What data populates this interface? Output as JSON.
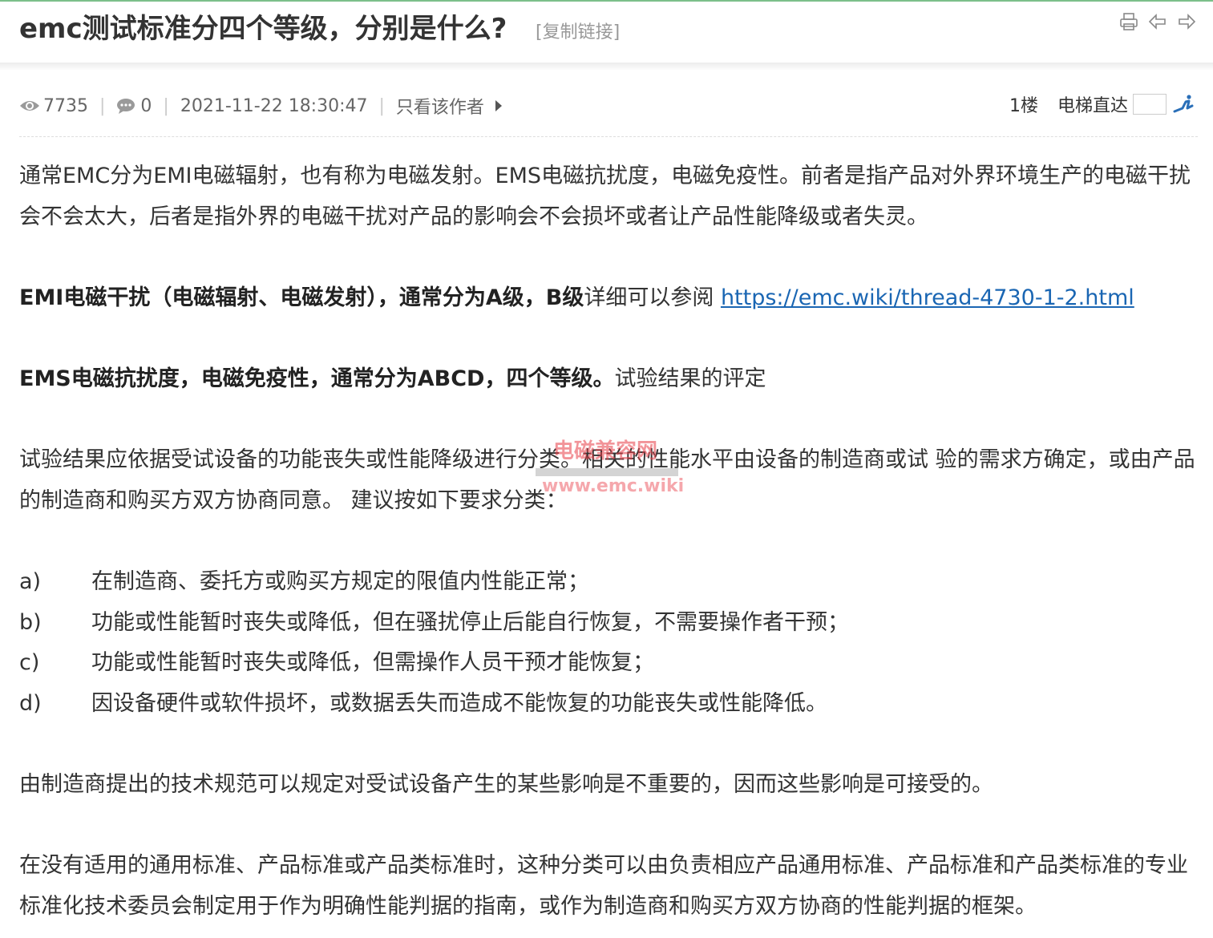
{
  "header": {
    "title": "emc测试标准分四个等级，分别是什么?",
    "copy_link": "[复制链接]",
    "icons": [
      "print-icon",
      "previous-thread-icon",
      "next-thread-icon"
    ]
  },
  "meta": {
    "views": "7735",
    "replies": "0",
    "datetime": "2021-11-22 18:30:47",
    "only_author": "只看该作者"
  },
  "floor": {
    "number": "1楼",
    "jump_label": "电梯直达",
    "jump_value": ""
  },
  "post": {
    "p1": "通常EMC分为EMI电磁辐射，也有称为电磁发射。EMS电磁抗扰度，电磁免疫性。前者是指产品对外界环境生产的电磁干扰会不会太大，后者是指外界的电磁干扰对产品的影响会不会损坏或者让产品性能降级或者失灵。",
    "p2_bold": "EMI电磁干扰（电磁辐射、电磁发射），通常分为A级，B级",
    "p2_text": "详细可以参阅 ",
    "p2_link": "https://emc.wiki/thread-4730-1-2.html",
    "p3_bold": "EMS电磁抗扰度，电磁免疫性，通常分为ABCD，四个等级。",
    "p3_text": "试验结果的评定",
    "p4": "试验结果应依据受试设备的功能丧失或性能降级进行分类。相关的性能水平由设备的制造商或试 验的需求方确定，或由产品的制造商和购买方双方协商同意。 建议按如下要求分类：",
    "list": [
      {
        "mark": "a)",
        "text": "在制造商、委托方或购买方规定的限值内性能正常；"
      },
      {
        "mark": "b)",
        "text": "功能或性能暂时丧失或降低，但在骚扰停止后能自行恢复，不需要操作者干预；"
      },
      {
        "mark": "c)",
        "text": "功能或性能暂时丧失或降低，但需操作人员干预才能恢复；"
      },
      {
        "mark": "d)",
        "text": "因设备硬件或软件损坏，或数据丢失而造成不能恢复的功能丧失或性能降低。"
      }
    ],
    "p5": "由制造商提出的技术规范可以规定对受试设备产生的某些影响是不重要的，因而这些影响是可接受的。",
    "p6": "在没有适用的通用标准、产品标准或产品类标准时，这种分类可以由负责相应产品通用标准、产品标准和产品类标准的专业标准化技术委员会制定用于作为明确性能判据的指南，或作为制造商和购买方双方协商的性能判据的框架。"
  },
  "watermark": {
    "top": "电磁兼容网",
    "bottom": "www.emc.wiki"
  },
  "colors": {
    "accent": "#7cbf8a",
    "link": "#1a66b3",
    "watermark": "#e83c46"
  }
}
